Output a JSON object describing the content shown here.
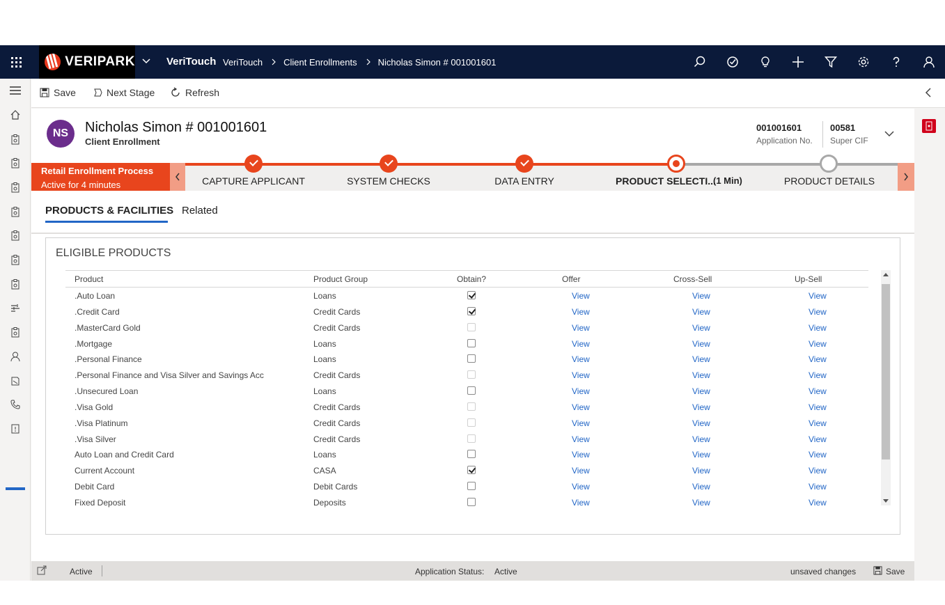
{
  "nav": {
    "brand": "VERIPARK",
    "app_name": "VeriTouch",
    "breadcrumbs": [
      "VeriTouch",
      "Client Enrollments",
      "Nicholas Simon # 001001601"
    ],
    "icons": [
      "search-icon",
      "task-icon",
      "lightbulb-icon",
      "plus-icon",
      "filter-icon",
      "gear-icon",
      "help-icon",
      "user-icon"
    ]
  },
  "commands": {
    "save": "Save",
    "next_stage": "Next Stage",
    "refresh": "Refresh"
  },
  "record": {
    "initials": "NS",
    "title": "Nicholas Simon # 001001601",
    "entity": "Client Enrollment",
    "application_no": "001001601",
    "application_no_label": "Application No.",
    "super_cif": "00581",
    "super_cif_label": "Super CIF"
  },
  "bpf": {
    "process_name": "Retail Enrollment Process",
    "active_for": "Active for 4 minutes",
    "stages": [
      {
        "label": "CAPTURE APPLICANT",
        "status": "done"
      },
      {
        "label": "SYSTEM CHECKS",
        "status": "done"
      },
      {
        "label": "DATA ENTRY",
        "status": "done"
      },
      {
        "label": "PRODUCT SELECTI...",
        "status": "active",
        "duration": "(1 Min)"
      },
      {
        "label": "PRODUCT DETAILS",
        "status": "todo"
      }
    ]
  },
  "tabs": [
    "PRODUCTS & FACILITIES",
    "Related"
  ],
  "section": {
    "title": "ELIGIBLE PRODUCTS",
    "columns": [
      "Product",
      "Product Group",
      "Obtain?",
      "Offer",
      "Cross-Sell",
      "Up-Sell"
    ],
    "rows": [
      {
        "product": ".Auto Loan",
        "group": "Loans",
        "obtain": "checked",
        "offer": "View",
        "cross": "View",
        "up": "View"
      },
      {
        "product": ".Credit Card",
        "group": "Credit Cards",
        "obtain": "checked",
        "offer": "View",
        "cross": "View",
        "up": "View"
      },
      {
        "product": ".MasterCard Gold",
        "group": "Credit Cards",
        "obtain": "disabled",
        "offer": "View",
        "cross": "View",
        "up": "View"
      },
      {
        "product": ".Mortgage",
        "group": "Loans",
        "obtain": "unchecked",
        "offer": "View",
        "cross": "View",
        "up": "View"
      },
      {
        "product": ".Personal Finance",
        "group": "Loans",
        "obtain": "unchecked",
        "offer": "View",
        "cross": "View",
        "up": "View"
      },
      {
        "product": ".Personal Finance and Visa Silver and Savings Acc",
        "group": "Credit Cards",
        "obtain": "disabled",
        "offer": "View",
        "cross": "View",
        "up": "View"
      },
      {
        "product": ".Unsecured Loan",
        "group": "Loans",
        "obtain": "unchecked",
        "offer": "View",
        "cross": "View",
        "up": "View"
      },
      {
        "product": ".Visa Gold",
        "group": "Credit Cards",
        "obtain": "disabled",
        "offer": "View",
        "cross": "View",
        "up": "View"
      },
      {
        "product": ".Visa Platinum",
        "group": "Credit Cards",
        "obtain": "disabled",
        "offer": "View",
        "cross": "View",
        "up": "View"
      },
      {
        "product": ".Visa Silver",
        "group": "Credit Cards",
        "obtain": "disabled",
        "offer": "View",
        "cross": "View",
        "up": "View"
      },
      {
        "product": "Auto Loan and Credit Card",
        "group": "Loans",
        "obtain": "unchecked",
        "offer": "View",
        "cross": "View",
        "up": "View"
      },
      {
        "product": "Current Account",
        "group": "CASA",
        "obtain": "checked",
        "offer": "View",
        "cross": "View",
        "up": "View"
      },
      {
        "product": "Debit Card",
        "group": "Debit Cards",
        "obtain": "unchecked",
        "offer": "View",
        "cross": "View",
        "up": "View"
      },
      {
        "product": "Fixed Deposit",
        "group": "Deposits",
        "obtain": "unchecked",
        "offer": "View",
        "cross": "View",
        "up": "View"
      }
    ]
  },
  "status": {
    "state": "Active",
    "app_status_label": "Application Status:",
    "app_status_value": "Active",
    "unsaved": "unsaved changes",
    "save": "Save"
  },
  "rail": {
    "badge": "V"
  },
  "colors": {
    "nav_bg": "#0b1a3a",
    "accent": "#e8451d",
    "link": "#2266c6",
    "avatar": "#6b2d8c"
  }
}
